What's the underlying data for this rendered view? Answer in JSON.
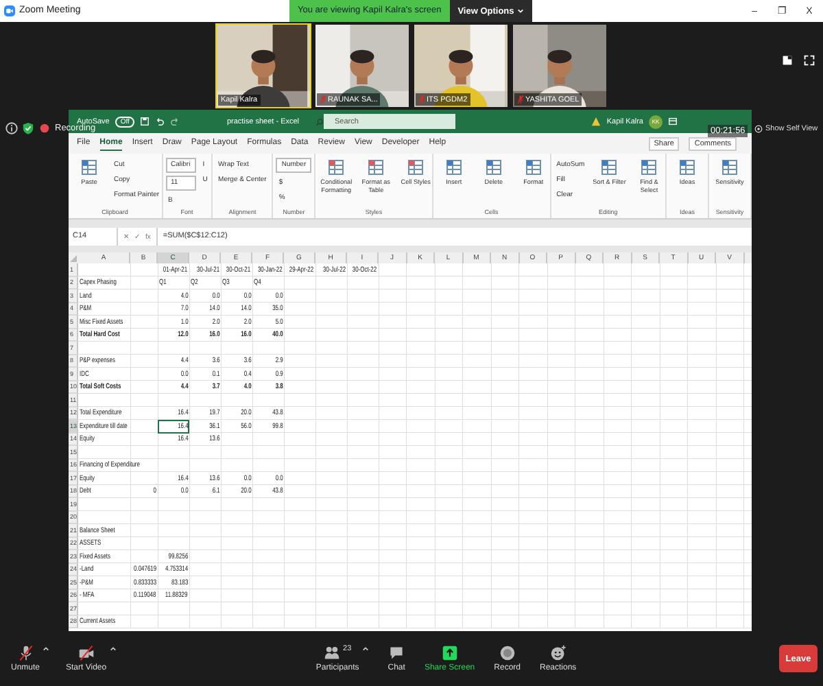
{
  "window": {
    "title": "Zoom Meeting",
    "banner": "You are viewing Kapil Kalra's screen",
    "view_options": "View Options",
    "controls": [
      "–",
      "❐",
      "X"
    ]
  },
  "videos": [
    {
      "name": "Kapil Kalra",
      "muted": false,
      "speaking": true
    },
    {
      "name": "RAUNAK SA...",
      "muted": true,
      "speaking": false
    },
    {
      "name": "ITS PGDM2",
      "muted": true,
      "speaking": false
    },
    {
      "name": "YASHITA GOEL",
      "muted": true,
      "speaking": false
    }
  ],
  "status": {
    "recording": "Recording",
    "timer": "00:21:56",
    "self_view": "Show Self View"
  },
  "excel": {
    "autosave": "AutoSave",
    "autosave_on": false,
    "autosave_state": "Off",
    "title": "practise sheet - Excel",
    "search_placeholder": "Search",
    "user": "Kapil Kalra",
    "initials": "KK",
    "tabs": [
      {
        "label": "File",
        "selected": false
      },
      {
        "label": "Home",
        "selected": true
      },
      {
        "label": "Insert",
        "selected": false
      },
      {
        "label": "Draw",
        "selected": false
      },
      {
        "label": "Page Layout",
        "selected": false
      },
      {
        "label": "Formulas",
        "selected": false
      },
      {
        "label": "Data",
        "selected": false
      },
      {
        "label": "Review",
        "selected": false
      },
      {
        "label": "View",
        "selected": false
      },
      {
        "label": "Developer",
        "selected": false
      },
      {
        "label": "Help",
        "selected": false
      }
    ],
    "share": "Share",
    "comments": "Comments",
    "ribbon": [
      {
        "label": "Clipboard",
        "items": [
          {
            "kind": "large",
            "text": "Paste"
          },
          {
            "kind": "small",
            "text": "Cut"
          },
          {
            "kind": "small",
            "text": "Copy"
          },
          {
            "kind": "small",
            "text": "Format Painter"
          }
        ]
      },
      {
        "label": "Font",
        "items": [
          {
            "kind": "field",
            "text": "Calibri"
          },
          {
            "kind": "field",
            "text": "11"
          },
          {
            "kind": "small",
            "text": "B"
          },
          {
            "kind": "small",
            "text": "I"
          },
          {
            "kind": "small",
            "text": "U"
          }
        ]
      },
      {
        "label": "Alignment",
        "items": [
          {
            "kind": "small",
            "text": "Wrap Text"
          },
          {
            "kind": "small",
            "text": "Merge & Center"
          }
        ]
      },
      {
        "label": "Number",
        "items": [
          {
            "kind": "field",
            "text": "Number"
          },
          {
            "kind": "small",
            "text": "$"
          },
          {
            "kind": "small",
            "text": "%"
          }
        ]
      },
      {
        "label": "Styles",
        "items": [
          {
            "kind": "large",
            "text": "Conditional Formatting"
          },
          {
            "kind": "large",
            "text": "Format as Table"
          },
          {
            "kind": "large",
            "text": "Cell Styles"
          }
        ]
      },
      {
        "label": "Cells",
        "items": [
          {
            "kind": "large",
            "text": "Insert"
          },
          {
            "kind": "large",
            "text": "Delete"
          },
          {
            "kind": "large",
            "text": "Format"
          }
        ]
      },
      {
        "label": "Editing",
        "items": [
          {
            "kind": "small",
            "text": "AutoSum"
          },
          {
            "kind": "small",
            "text": "Fill"
          },
          {
            "kind": "small",
            "text": "Clear"
          },
          {
            "kind": "large",
            "text": "Sort & Filter"
          },
          {
            "kind": "large",
            "text": "Find & Select"
          }
        ]
      },
      {
        "label": "Ideas",
        "items": [
          {
            "kind": "large",
            "text": "Ideas"
          }
        ]
      },
      {
        "label": "Sensitivity",
        "items": [
          {
            "kind": "large",
            "text": "Sensitivity"
          }
        ]
      }
    ],
    "name_box": "C14",
    "formula_icons": [
      "✕",
      "✓",
      "fx"
    ],
    "formula": "=SUM($C$12:C12)",
    "columns": [
      "A",
      "B",
      "C",
      "D",
      "E",
      "F",
      "G",
      "H",
      "I",
      "J",
      "K",
      "L",
      "M",
      "N",
      "O",
      "P",
      "Q",
      "R",
      "S",
      "T",
      "U",
      "V"
    ],
    "rows": [
      {
        "num": "1",
        "bold": false,
        "cells": {
          "C": {
            "kind": "number",
            "text": "01-Apr-21",
            "selected": false
          },
          "D": {
            "kind": "number",
            "text": "30-Jul-21",
            "selected": false
          },
          "E": {
            "kind": "number",
            "text": "30-Oct-21",
            "selected": false
          },
          "F": {
            "kind": "number",
            "text": "30-Jan-22",
            "selected": false
          },
          "G": {
            "kind": "number",
            "text": "29-Apr-22",
            "selected": false
          },
          "H": {
            "kind": "number",
            "text": "30-Jul-22",
            "selected": false
          },
          "I": {
            "kind": "number",
            "text": "30-Oct-22",
            "selected": false
          }
        }
      },
      {
        "num": "2",
        "bold": false,
        "cells": {
          "A": {
            "kind": "text",
            "text": "Capex Phasing",
            "selected": false
          },
          "C": {
            "kind": "text",
            "text": "Q1",
            "selected": false
          },
          "D": {
            "kind": "text",
            "text": "Q2",
            "selected": false
          },
          "E": {
            "kind": "text",
            "text": "Q3",
            "selected": false
          },
          "F": {
            "kind": "text",
            "text": "Q4",
            "selected": false
          }
        }
      },
      {
        "num": "3",
        "bold": false,
        "cells": {
          "A": {
            "kind": "text",
            "text": "Land",
            "selected": false
          },
          "C": {
            "kind": "number",
            "text": "4.0",
            "selected": false
          },
          "D": {
            "kind": "number",
            "text": "0.0",
            "selected": false
          },
          "E": {
            "kind": "number",
            "text": "0.0",
            "selected": false
          },
          "F": {
            "kind": "number",
            "text": "0.0",
            "selected": false
          }
        }
      },
      {
        "num": "4",
        "bold": false,
        "cells": {
          "A": {
            "kind": "text",
            "text": "P&M",
            "selected": false
          },
          "C": {
            "kind": "number",
            "text": "7.0",
            "selected": false
          },
          "D": {
            "kind": "number",
            "text": "14.0",
            "selected": false
          },
          "E": {
            "kind": "number",
            "text": "14.0",
            "selected": false
          },
          "F": {
            "kind": "number",
            "text": "35.0",
            "selected": false
          }
        }
      },
      {
        "num": "5",
        "bold": false,
        "cells": {
          "A": {
            "kind": "text",
            "text": "Misc Fixed Assets",
            "selected": false
          },
          "C": {
            "kind": "number",
            "text": "1.0",
            "selected": false
          },
          "D": {
            "kind": "number",
            "text": "2.0",
            "selected": false
          },
          "E": {
            "kind": "number",
            "text": "2.0",
            "selected": false
          },
          "F": {
            "kind": "number",
            "text": "5.0",
            "selected": false
          }
        }
      },
      {
        "num": "6",
        "bold": true,
        "cells": {
          "A": {
            "kind": "text",
            "text": "Total Hard Cost",
            "selected": false
          },
          "C": {
            "kind": "number",
            "text": "12.0",
            "selected": false
          },
          "D": {
            "kind": "number",
            "text": "16.0",
            "selected": false
          },
          "E": {
            "kind": "number",
            "text": "16.0",
            "selected": false
          },
          "F": {
            "kind": "number",
            "text": "40.0",
            "selected": false
          }
        }
      },
      {
        "num": "7"
      },
      {
        "num": "8",
        "bold": false,
        "cells": {
          "A": {
            "kind": "text",
            "text": "P&P expenses",
            "selected": false
          },
          "C": {
            "kind": "number",
            "text": "4.4",
            "selected": false
          },
          "D": {
            "kind": "number",
            "text": "3.6",
            "selected": false
          },
          "E": {
            "kind": "number",
            "text": "3.6",
            "selected": false
          },
          "F": {
            "kind": "number",
            "text": "2.9",
            "selected": false
          }
        }
      },
      {
        "num": "9",
        "bold": false,
        "cells": {
          "A": {
            "kind": "text",
            "text": "IDC",
            "selected": false
          },
          "C": {
            "kind": "number",
            "text": "0.0",
            "selected": false
          },
          "D": {
            "kind": "number",
            "text": "0.1",
            "selected": false
          },
          "E": {
            "kind": "number",
            "text": "0.4",
            "selected": false
          },
          "F": {
            "kind": "number",
            "text": "0.9",
            "selected": false
          }
        }
      },
      {
        "num": "10",
        "bold": true,
        "cells": {
          "A": {
            "kind": "text",
            "text": "Total Soft Costs",
            "selected": false
          },
          "C": {
            "kind": "number",
            "text": "4.4",
            "selected": false
          },
          "D": {
            "kind": "number",
            "text": "3.7",
            "selected": false
          },
          "E": {
            "kind": "number",
            "text": "4.0",
            "selected": false
          },
          "F": {
            "kind": "number",
            "text": "3.8",
            "selected": false
          }
        }
      },
      {
        "num": "11"
      },
      {
        "num": "12",
        "bold": false,
        "cells": {
          "A": {
            "kind": "text",
            "text": "Total Expenditure",
            "selected": false
          },
          "C": {
            "kind": "number",
            "text": "16.4",
            "selected": false
          },
          "D": {
            "kind": "number",
            "text": "19.7",
            "selected": false
          },
          "E": {
            "kind": "number",
            "text": "20.0",
            "selected": false
          },
          "F": {
            "kind": "number",
            "text": "43.8",
            "selected": false
          }
        }
      },
      {
        "num": "13",
        "bold": false,
        "cells": {
          "A": {
            "kind": "text",
            "text": "Expenditure till date",
            "selected": false
          },
          "C": {
            "kind": "number",
            "text": "16.4",
            "selected": true
          },
          "D": {
            "kind": "number",
            "text": "36.1",
            "selected": false
          },
          "E": {
            "kind": "number",
            "text": "56.0",
            "selected": false
          },
          "F": {
            "kind": "number",
            "text": "99.8",
            "selected": false
          }
        }
      },
      {
        "num": "14",
        "bold": false,
        "cells": {
          "A": {
            "kind": "text",
            "text": "Equity",
            "selected": false
          },
          "C": {
            "kind": "number",
            "text": "16.4",
            "selected": false
          },
          "D": {
            "kind": "number",
            "text": "13.6",
            "selected": false
          }
        }
      },
      {
        "num": "15"
      },
      {
        "num": "16",
        "bold": false,
        "cells": {
          "A": {
            "kind": "text",
            "text": "Financing of Expenditure",
            "selected": false
          }
        }
      },
      {
        "num": "17",
        "bold": false,
        "cells": {
          "A": {
            "kind": "text",
            "text": "Equity",
            "selected": false
          },
          "C": {
            "kind": "number",
            "text": "16.4",
            "selected": false
          },
          "D": {
            "kind": "number",
            "text": "13.6",
            "selected": false
          },
          "E": {
            "kind": "number",
            "text": "0.0",
            "selected": false
          },
          "F": {
            "kind": "number",
            "text": "0.0",
            "selected": false
          }
        }
      },
      {
        "num": "18",
        "bold": false,
        "cells": {
          "A": {
            "kind": "text",
            "text": "Debt",
            "selected": false
          },
          "B": {
            "kind": "number",
            "text": "0",
            "selected": false
          },
          "C": {
            "kind": "number",
            "text": "0.0",
            "selected": false
          },
          "D": {
            "kind": "number",
            "text": "6.1",
            "selected": false
          },
          "E": {
            "kind": "number",
            "text": "20.0",
            "selected": false
          },
          "F": {
            "kind": "number",
            "text": "43.8",
            "selected": false
          }
        }
      },
      {
        "num": "19"
      },
      {
        "num": "20"
      },
      {
        "num": "21",
        "bold": false,
        "cells": {
          "A": {
            "kind": "text",
            "text": "Balance Sheet",
            "selected": false
          }
        }
      },
      {
        "num": "22",
        "bold": false,
        "cells": {
          "A": {
            "kind": "text",
            "text": "ASSETS",
            "selected": false
          }
        }
      },
      {
        "num": "23",
        "bold": false,
        "cells": {
          "A": {
            "kind": "text",
            "text": "Fixed Assets",
            "selected": false
          },
          "C": {
            "kind": "number",
            "text": "99.8256",
            "selected": false
          }
        }
      },
      {
        "num": "24",
        "bold": false,
        "cells": {
          "A": {
            "kind": "text",
            "text": "-Land",
            "selected": false
          },
          "B": {
            "kind": "number",
            "text": "0.047619",
            "selected": false
          },
          "C": {
            "kind": "number",
            "text": "4.753314",
            "selected": false
          }
        }
      },
      {
        "num": "25",
        "bold": false,
        "cells": {
          "A": {
            "kind": "text",
            "text": "-P&M",
            "selected": false
          },
          "B": {
            "kind": "number",
            "text": "0.833333",
            "selected": false
          },
          "C": {
            "kind": "number",
            "text": "83.183",
            "selected": false
          }
        }
      },
      {
        "num": "26",
        "bold": false,
        "cells": {
          "A": {
            "kind": "text",
            "text": "- MFA",
            "selected": false
          },
          "B": {
            "kind": "number",
            "text": "0.119048",
            "selected": false
          },
          "C": {
            "kind": "number",
            "text": "11.88329",
            "selected": false
          }
        }
      },
      {
        "num": "27"
      },
      {
        "num": "28",
        "bold": false,
        "cells": {
          "A": {
            "kind": "text",
            "text": "Current Assets",
            "selected": false
          }
        }
      }
    ]
  },
  "toolbar": {
    "items": [
      {
        "kind": "mic",
        "label": "Unmute",
        "caret": true
      },
      {
        "kind": "video",
        "label": "Start Video",
        "caret": true
      },
      {
        "kind": "participants",
        "label": "Participants",
        "count": "23",
        "caret": true
      },
      {
        "kind": "chat",
        "label": "Chat",
        "caret": false
      },
      {
        "kind": "share",
        "label": "Share Screen",
        "caret": false
      },
      {
        "kind": "record",
        "label": "Record",
        "caret": false
      },
      {
        "kind": "reactions",
        "label": "Reactions",
        "caret": false
      }
    ],
    "leave": "Leave"
  }
}
